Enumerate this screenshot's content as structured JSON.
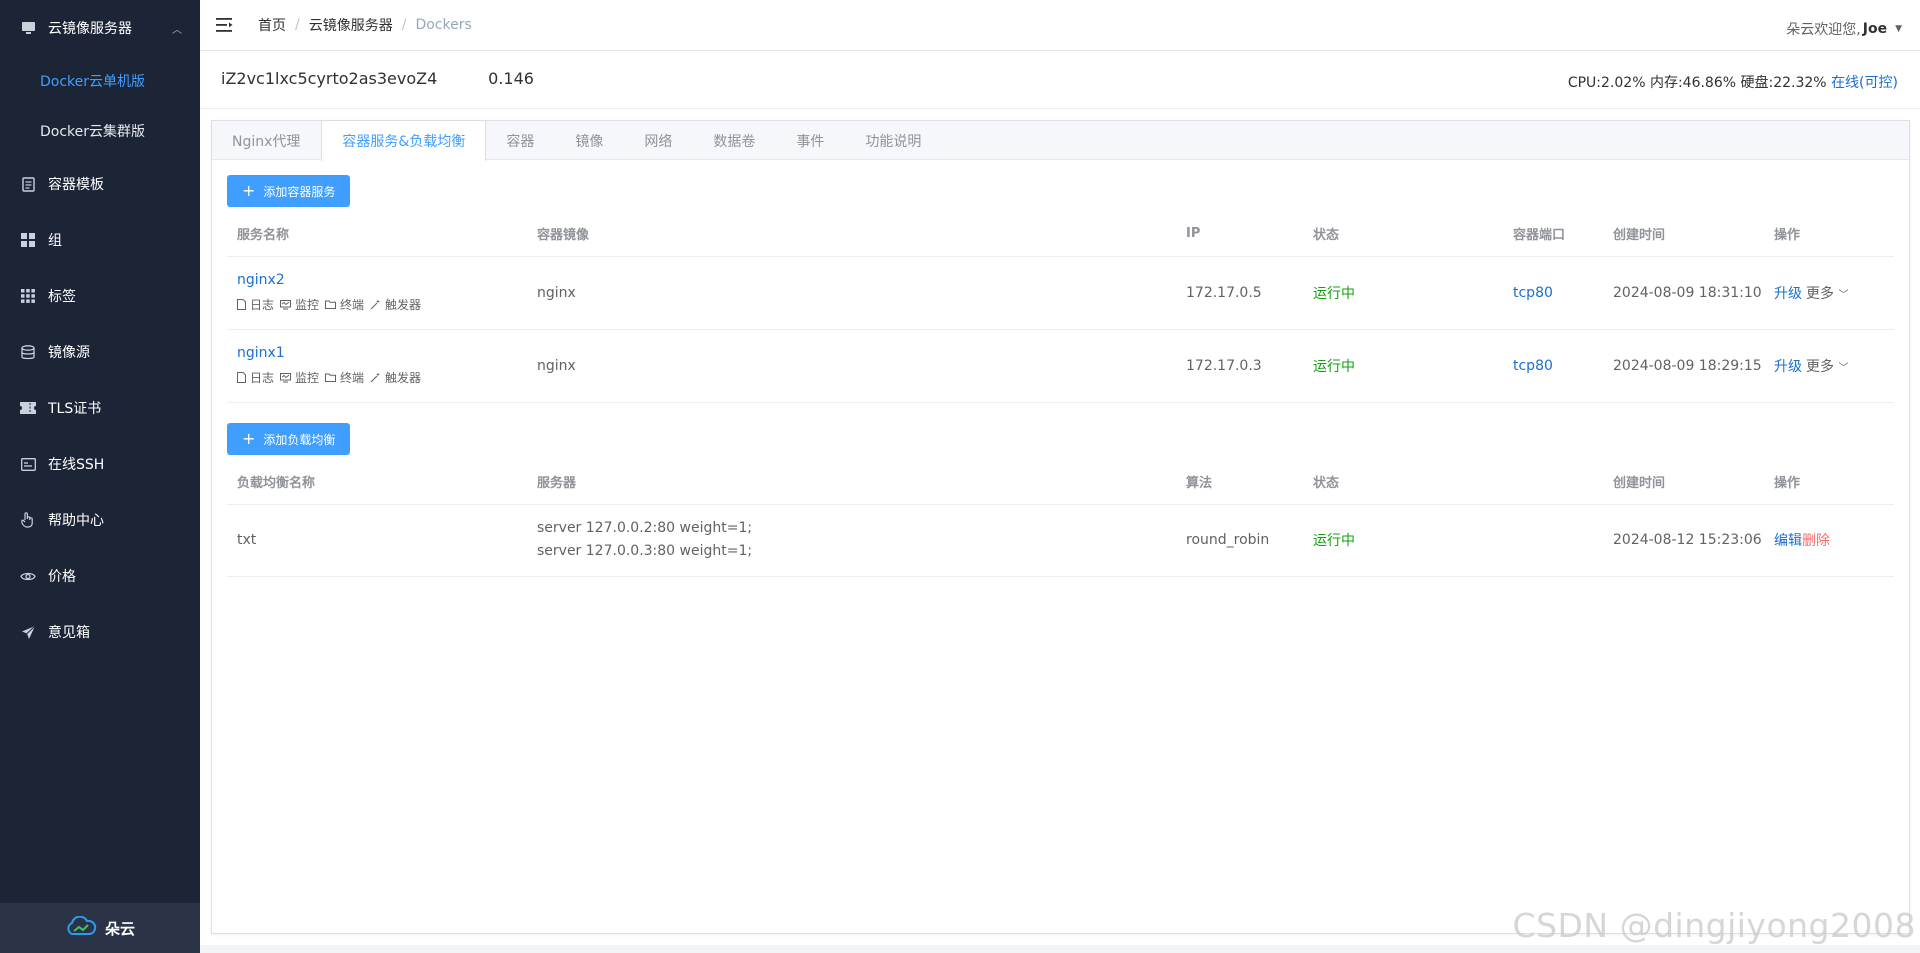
{
  "sidebar": {
    "group": {
      "label": "云镜像服务器",
      "icon": "monitor-icon"
    },
    "sub_items": [
      {
        "label": "Docker云单机版",
        "active": true
      },
      {
        "label": "Docker云集群版",
        "active": false
      }
    ],
    "items": [
      {
        "label": "容器模板",
        "icon": "document-icon"
      },
      {
        "label": "组",
        "icon": "grid-icon"
      },
      {
        "label": "标签",
        "icon": "apps-icon"
      },
      {
        "label": "镜像源",
        "icon": "database-icon"
      },
      {
        "label": "TLS证书",
        "icon": "ticket-icon"
      },
      {
        "label": "在线SSH",
        "icon": "terminal-icon"
      },
      {
        "label": "帮助中心",
        "icon": "hand-icon"
      },
      {
        "label": "价格",
        "icon": "eye-icon"
      },
      {
        "label": "意见箱",
        "icon": "send-icon"
      }
    ],
    "footer": {
      "label": "朵云",
      "icon": "cloud-logo-icon"
    }
  },
  "header": {
    "breadcrumb": [
      "首页",
      "云镜像服务器",
      "Dockers"
    ],
    "welcome": "朵云欢迎您,",
    "username": "Joe"
  },
  "server": {
    "name": "iZ2vc1lxc5cyrto2as3evoZ4          0.146",
    "stats": "CPU:2.02% 内存:46.86% 硬盘:22.32% ",
    "status_link": "在线(可控)"
  },
  "tabs": [
    "Nginx代理",
    "容器服务&负载均衡",
    "容器",
    "镜像",
    "网络",
    "数据卷",
    "事件",
    "功能说明"
  ],
  "active_tab": 1,
  "services": {
    "add_label": "添加容器服务",
    "columns": [
      "服务名称",
      "容器镜像",
      "IP",
      "状态",
      "容器端口",
      "创建时间",
      "操作"
    ],
    "row_actions": [
      "日志",
      "监控",
      "终端",
      "触发器"
    ],
    "rows": [
      {
        "name": "nginx2",
        "image": "nginx",
        "ip": "172.17.0.5",
        "status": "运行中",
        "port": "tcp80",
        "created": "2024-08-09 18:31:10",
        "upgrade": "升级",
        "more": "更多"
      },
      {
        "name": "nginx1",
        "image": "nginx",
        "ip": "172.17.0.3",
        "status": "运行中",
        "port": "tcp80",
        "created": "2024-08-09 18:29:15",
        "upgrade": "升级",
        "more": "更多"
      }
    ]
  },
  "load_balancers": {
    "add_label": "添加负载均衡",
    "columns": [
      "负载均衡名称",
      "服务器",
      "算法",
      "状态",
      "创建时间",
      "操作"
    ],
    "rows": [
      {
        "name": "txt",
        "servers": [
          "server 127.0.0.2:80 weight=1;",
          "server 127.0.0.3:80 weight=1;"
        ],
        "algorithm": "round_robin",
        "status": "运行中",
        "created": "2024-08-12 15:23:06",
        "edit": "编辑",
        "delete": "删除"
      }
    ]
  },
  "watermark": "CSDN @dingjiyong2008",
  "colors": {
    "sidebar_bg": "#1c2536",
    "accent": "#409eff",
    "link": "#1a6fd1",
    "running": "#13a10e",
    "danger": "#f56c6c"
  }
}
